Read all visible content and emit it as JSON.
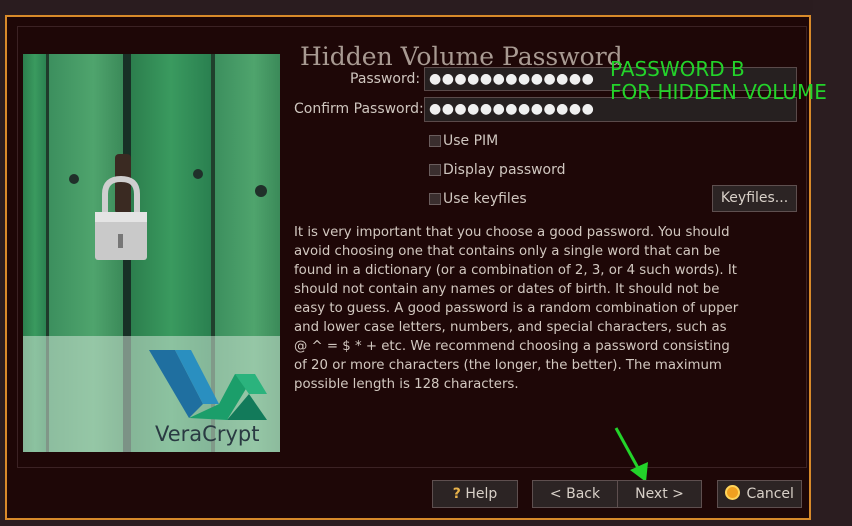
{
  "dialog": {
    "title": "Hidden Volume Password",
    "password_label": "Password:",
    "password_value": "●●●●●●●●●●●●●",
    "confirm_label": "Confirm Password:",
    "confirm_value": "●●●●●●●●●●●●●",
    "options": {
      "use_pim": "Use PIM",
      "display_password": "Display password",
      "use_keyfiles": "Use keyfiles"
    },
    "keyfiles_button": "Keyfiles...",
    "description": "It is very important that you choose a good password. You should avoid choosing one that contains only a single word that can be found in a dictionary (or a combination of 2, 3, or 4 such words). It should not contain any names or dates of birth. It should not be easy to guess. A good password is a random combination of upper and lower case letters, numbers, and special characters, such as @ ^ = $ * + etc. We recommend choosing a password consisting of 20 or more characters (the longer, the better). The maximum possible length is 128 characters.",
    "logo_text": "VeraCrypt"
  },
  "annotation": {
    "line1": "PASSWORD B",
    "line2": "FOR HIDDEN VOLUME",
    "color": "#23d32a"
  },
  "buttons": {
    "help": "Help",
    "help_icon": "?",
    "back": "< Back",
    "next": "Next >",
    "cancel": "Cancel"
  },
  "colors": {
    "accent_border": "#d88a2a",
    "window_bg": "#1e0707"
  }
}
